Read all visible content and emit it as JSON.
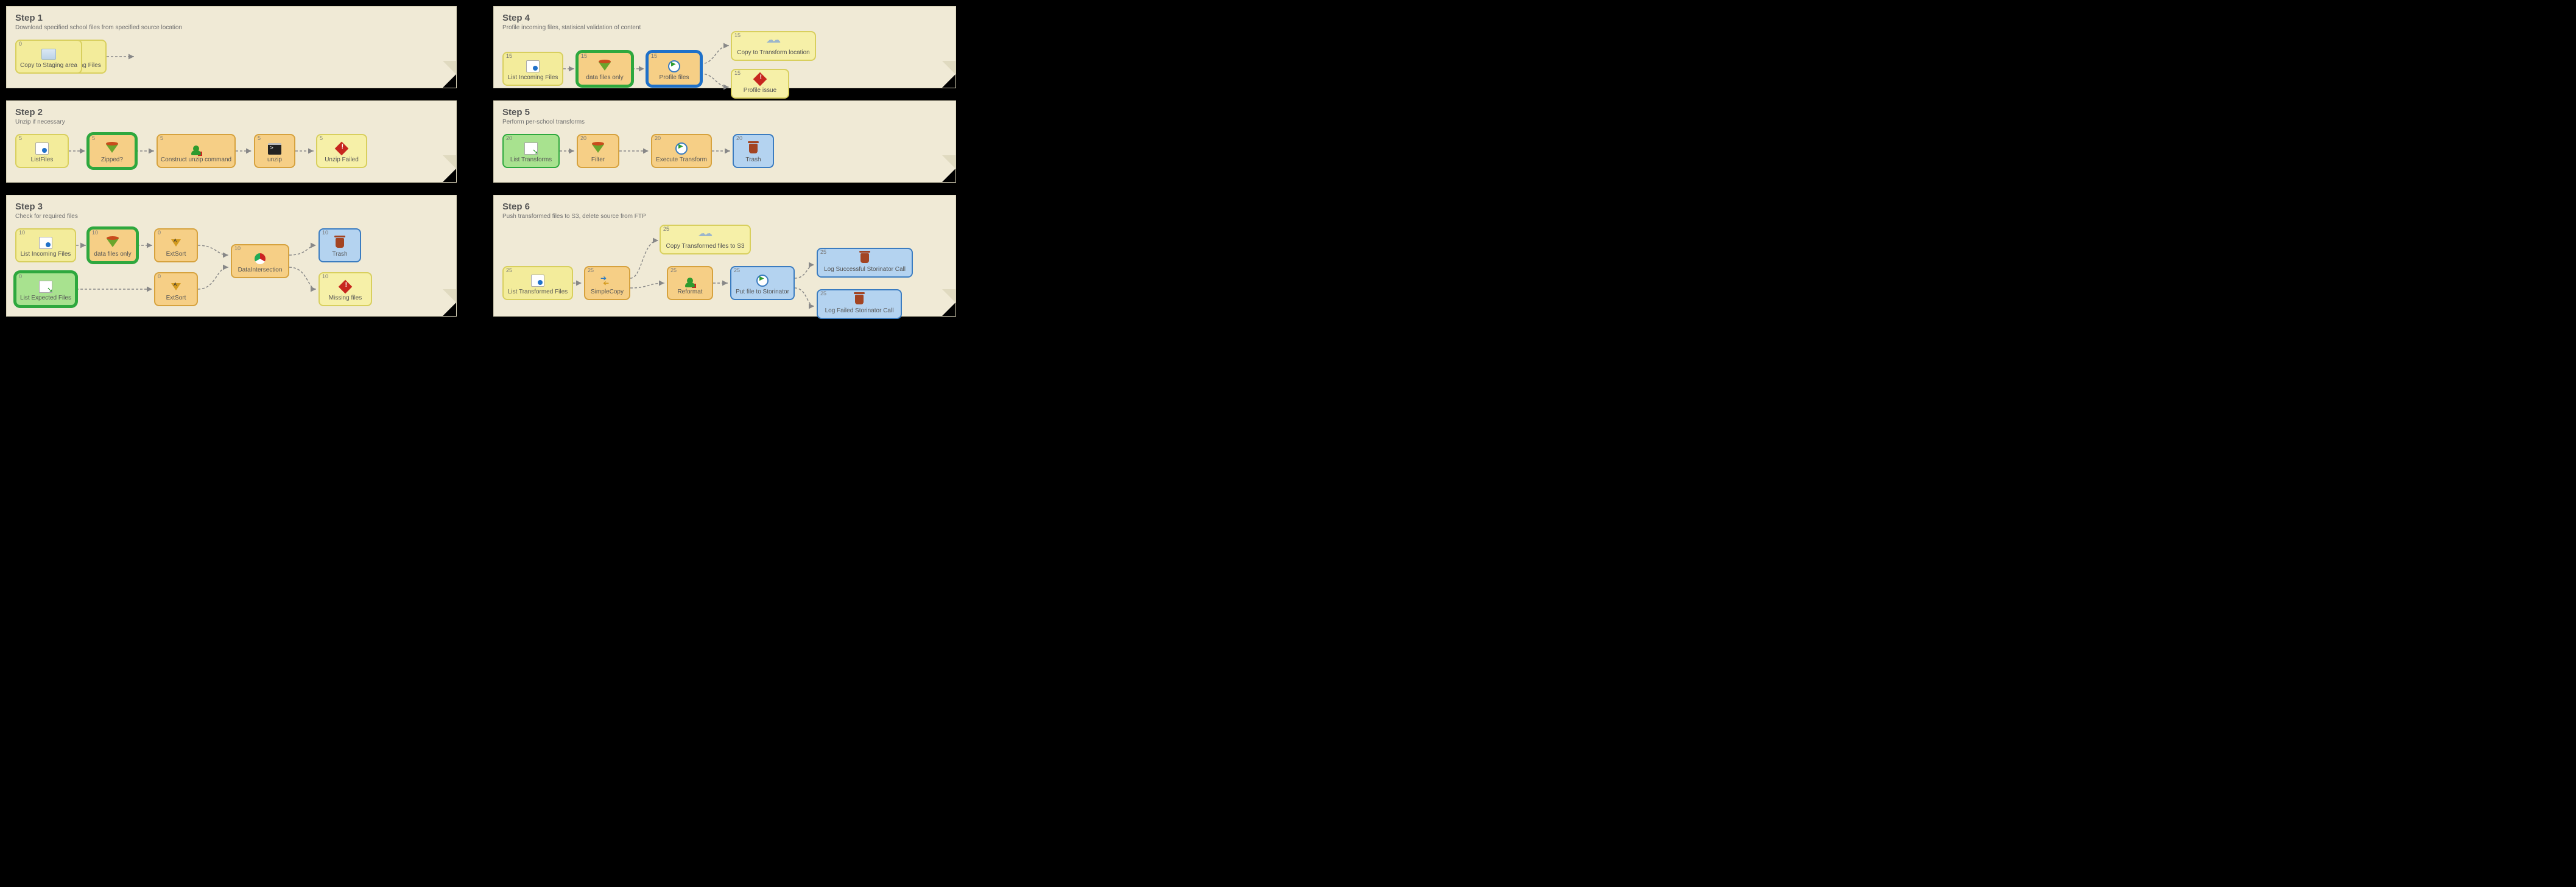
{
  "steps": {
    "s1": {
      "title": "Step 1",
      "sub": "Download specified school files from specified source location"
    },
    "s2": {
      "title": "Step 2",
      "sub": "Unzip if necessary"
    },
    "s3": {
      "title": "Step 3",
      "sub": "Check for required files"
    },
    "s4": {
      "title": "Step 4",
      "sub": "Profile incoming files, statisical validation of content"
    },
    "s5": {
      "title": "Step 5",
      "sub": "Perform per-school transforms"
    },
    "s6": {
      "title": "Step 6",
      "sub": "Push transformed files to S3, delete source from FTP"
    }
  },
  "nodes": {
    "s1n1": {
      "badge": "0",
      "label": "Check FTP for Incoming Files"
    },
    "s1n2": {
      "badge": "0",
      "label": "Copy to Staging area"
    },
    "s2n1": {
      "badge": "5",
      "label": "ListFiles"
    },
    "s2n2": {
      "badge": "5",
      "label": "Zipped?"
    },
    "s2n3": {
      "badge": "5",
      "label": "Construct unzip command"
    },
    "s2n4": {
      "badge": "5",
      "label": "unzip"
    },
    "s2n5": {
      "badge": "5",
      "label": "Unzip Failed"
    },
    "s3n1": {
      "badge": "10",
      "label": "List Incoming Files"
    },
    "s3n2": {
      "badge": "10",
      "label": "data files only"
    },
    "s3n3": {
      "badge": "0",
      "label": "ExtSort"
    },
    "s3n4": {
      "badge": "0",
      "label": "List Expected Files"
    },
    "s3n5": {
      "badge": "0",
      "label": "ExtSort"
    },
    "s3n6": {
      "badge": "10",
      "label": "DataIntersection"
    },
    "s3n7": {
      "badge": "10",
      "label": "Trash"
    },
    "s3n8": {
      "badge": "10",
      "label": "Missing files"
    },
    "s4n1": {
      "badge": "15",
      "label": "List Incoming Files"
    },
    "s4n2": {
      "badge": "15",
      "label": "data files only"
    },
    "s4n3": {
      "badge": "15",
      "label": "Profile files"
    },
    "s4n4": {
      "badge": "15",
      "label": "Copy to Transform location"
    },
    "s4n5": {
      "badge": "15",
      "label": "Profile issue"
    },
    "s5n1": {
      "badge": "20",
      "label": "List Transforms"
    },
    "s5n2": {
      "badge": "20",
      "label": "Filter"
    },
    "s5n3": {
      "badge": "20",
      "label": "Execute Transform"
    },
    "s5n4": {
      "badge": "20",
      "label": "Trash"
    },
    "s6n1": {
      "badge": "25",
      "label": "List Transformed Files"
    },
    "s6n2": {
      "badge": "25",
      "label": "SimpleCopy"
    },
    "s6n3": {
      "badge": "25",
      "label": "Copy Transformed files to S3"
    },
    "s6n4": {
      "badge": "25",
      "label": "Reformat"
    },
    "s6n5": {
      "badge": "25",
      "label": "Put file to Storinator"
    },
    "s6n6": {
      "badge": "25",
      "label": "Log Successful Storinator Call"
    },
    "s6n7": {
      "badge": "25",
      "label": "Log Failed Storinator Call"
    }
  }
}
